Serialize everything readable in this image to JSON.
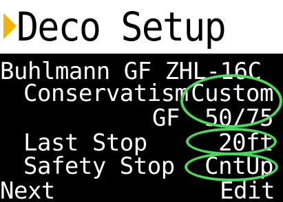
{
  "title": "Deco Setup",
  "model_line": "Buhlmann GF ZHL-16C",
  "rows": {
    "conservatism": {
      "label": "Conservatism",
      "value": "Custom"
    },
    "gf": {
      "label": "GF",
      "value": "50/75"
    },
    "last_stop": {
      "label": "Last Stop",
      "value": "20ft"
    },
    "safety_stop": {
      "label": "Safety Stop",
      "value": "CntUp"
    }
  },
  "softkeys": {
    "left": "Next",
    "right": "Edit"
  },
  "colors": {
    "background": "#000000",
    "title_bar": "#ffffff",
    "title_arrow": "#f0b400",
    "highlight": "#4cd85c"
  }
}
